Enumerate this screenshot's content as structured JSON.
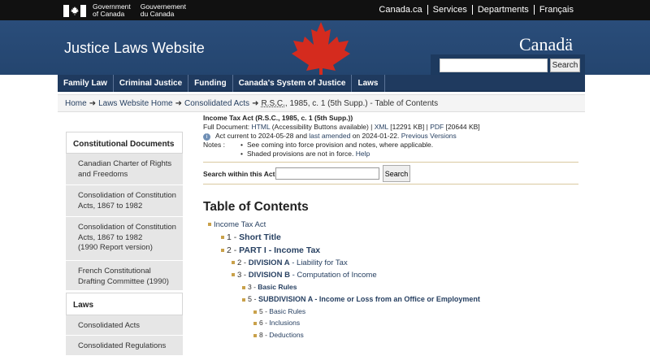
{
  "header": {
    "gov_en": "Government\nof Canada",
    "gov_fr": "Gouvernement\ndu Canada",
    "links": [
      "Canada.ca",
      "Services",
      "Departments",
      "Français"
    ]
  },
  "banner": {
    "title": "Justice Laws Website",
    "wordmark": "Canadä",
    "search_button": "Search",
    "search_placeholder": ""
  },
  "nav": [
    "Family Law",
    "Criminal Justice",
    "Funding",
    "Canada's System of Justice",
    "Laws"
  ],
  "breadcrumb": {
    "home": "Home",
    "laws_home": "Laws Website Home",
    "consolidated": "Consolidated Acts",
    "rsc": "R.S.C.",
    "tail": ", 1985, c. 1 (5th Supp.) -  Table of Contents"
  },
  "sidebar": {
    "heading1": "Constitutional Documents",
    "items": [
      "Canadian Charter of Rights and Freedoms",
      "Consolidation of Constitution Acts, 1867 to 1982",
      "Consolidation of Constitution Acts, 1867 to 1982\n(1990 Report version)",
      "French Constitutional Drafting Committee (1990)"
    ],
    "heading2": "Laws",
    "items2": [
      "Consolidated Acts",
      "Consolidated Regulations"
    ]
  },
  "act": {
    "title": "Income Tax Act (R.S.C., 1985, c. 1 (5th Supp.))",
    "full_doc_label": "Full Document: ",
    "html": "HTML",
    "html_note": " (Accessibility Buttons available) | ",
    "xml": "XML",
    "xml_size": " [12291 KB] | ",
    "pdf": "PDF",
    "pdf_size": " [20644 KB]",
    "current_pre": "Act current to 2024-05-28 and ",
    "last_amended": "last amended",
    "current_mid": " on 2024-01-22. ",
    "previous_versions": "Previous Versions",
    "notes_label": "Notes :",
    "note1": "See coming into force provision and notes, where applicable.",
    "note2_pre": "Shaded provisions are not in force. ",
    "help": "Help"
  },
  "search_act": {
    "label": "Search within this Act:",
    "button": "Search"
  },
  "toc": {
    "title": "Table of Contents",
    "rows": [
      {
        "prefix": "",
        "link": "Income Tax Act",
        "suffix": ""
      },
      {
        "prefix": "1 - ",
        "link": "Short Title",
        "suffix": ""
      },
      {
        "prefix": "2 - ",
        "link": "PART I - Income Tax",
        "suffix": ""
      },
      {
        "prefix": "2 - ",
        "link": "DIVISION A",
        "suffix": " - Liability for Tax"
      },
      {
        "prefix": "3 - ",
        "link": "DIVISION B",
        "suffix": " - Computation of Income"
      },
      {
        "prefix": "3 - ",
        "link": "Basic Rules",
        "suffix": ""
      },
      {
        "prefix": "5 - ",
        "link": "SUBDIVISION A",
        "suffix": " - Income or Loss from an Office or Employment"
      },
      {
        "prefix": "5 - ",
        "link": "Basic Rules",
        "suffix": ""
      },
      {
        "prefix": "6 - ",
        "link": "Inclusions",
        "suffix": ""
      },
      {
        "prefix": "8 - ",
        "link": "Deductions",
        "suffix": ""
      }
    ]
  }
}
